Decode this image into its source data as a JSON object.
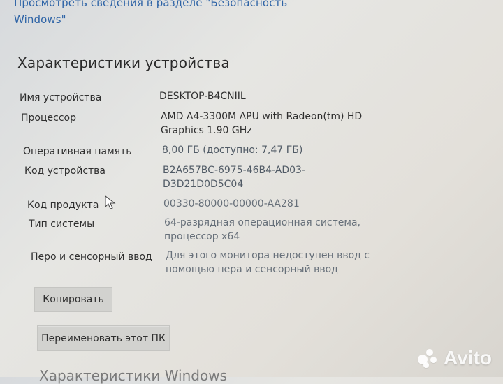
{
  "header": {
    "link_text": "Просмотреть сведения в разделе \"Безопасность\nWindows\""
  },
  "device_specs": {
    "title": "Характеристики устройства",
    "rows": [
      {
        "label": "Имя устройства",
        "value": "DESKTOP-B4CNIIL"
      },
      {
        "label": "Процессор",
        "value": "AMD A4-3300M APU with Radeon(tm) HD\nGraphics 1.90 GHz"
      },
      {
        "label": "Оперативная память",
        "value": "8,00 ГБ (доступно: 7,47 ГБ)"
      },
      {
        "label": "Код устройства",
        "value": "B2A657BC-6975-46B4-AD03-\nD3D21D0D5C04"
      },
      {
        "label": "Код продукта",
        "value": "00330-80000-00000-AA281"
      },
      {
        "label": "Тип системы",
        "value": "64-разрядная операционная система,\nпроцессор x64"
      },
      {
        "label": "Перо и сенсорный ввод",
        "value": "Для этого монитора недоступен ввод с\nпомощью пера и сенсорный ввод"
      }
    ]
  },
  "buttons": {
    "copy_label": "Копировать",
    "rename_label": "Переименовать этот ПК"
  },
  "footer": {
    "windows_specs_title": "Характеристики Windows"
  },
  "watermark": {
    "text": "Avito",
    "icon": "avito-logo-icon"
  },
  "pointer": {
    "icon": "mouse-pointer-icon"
  },
  "colors": {
    "link": "#2d63a6",
    "title": "#2a2a2a",
    "label": "#2f2f2f",
    "value_muted": "#666f79",
    "button_bg": "#d2d2cf"
  }
}
